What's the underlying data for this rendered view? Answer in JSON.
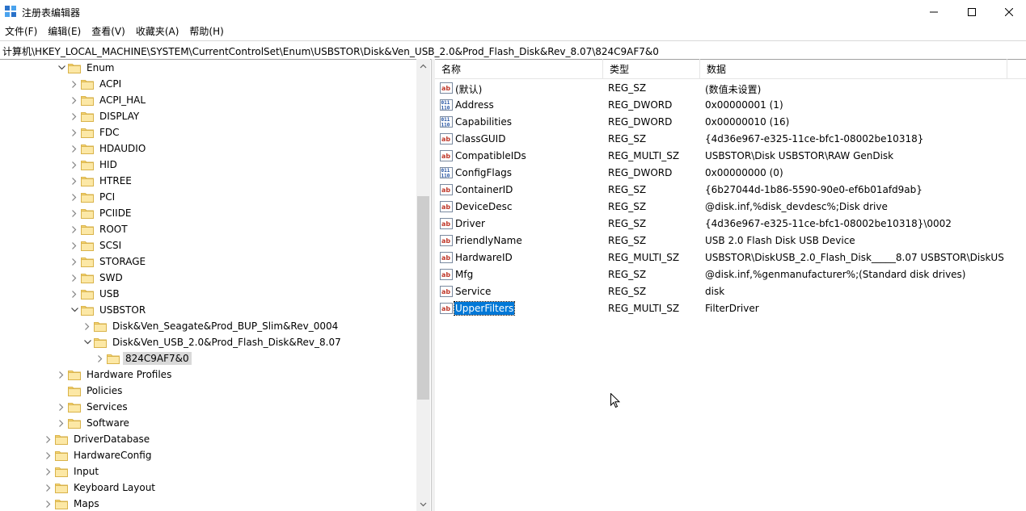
{
  "window": {
    "title": "注册表编辑器"
  },
  "menu": [
    "文件(F)",
    "编辑(E)",
    "查看(V)",
    "收藏夹(A)",
    "帮助(H)"
  ],
  "address": "计算机\\HKEY_LOCAL_MACHINE\\SYSTEM\\CurrentControlSet\\Enum\\USBSTOR\\Disk&Ven_USB_2.0&Prod_Flash_Disk&Rev_8.07\\824C9AF7&0",
  "tree": [
    {
      "label": "Enum",
      "expanded": true
    },
    {
      "label": "ACPI"
    },
    {
      "label": "ACPI_HAL"
    },
    {
      "label": "DISPLAY"
    },
    {
      "label": "FDC"
    },
    {
      "label": "HDAUDIO"
    },
    {
      "label": "HID"
    },
    {
      "label": "HTREE"
    },
    {
      "label": "PCI"
    },
    {
      "label": "PCIIDE"
    },
    {
      "label": "ROOT"
    },
    {
      "label": "SCSI"
    },
    {
      "label": "STORAGE"
    },
    {
      "label": "SWD"
    },
    {
      "label": "USB"
    },
    {
      "label": "USBSTOR",
      "expanded": true
    },
    {
      "label": "Disk&Ven_Seagate&Prod_BUP_Slim&Rev_0004"
    },
    {
      "label": "Disk&Ven_USB_2.0&Prod_Flash_Disk&Rev_8.07",
      "expanded": true
    },
    {
      "label": "824C9AF7&0",
      "selected": true
    },
    {
      "label": "Hardware Profiles"
    },
    {
      "label": "Policies"
    },
    {
      "label": "Services"
    },
    {
      "label": "Software"
    },
    {
      "label": "DriverDatabase"
    },
    {
      "label": "HardwareConfig"
    },
    {
      "label": "Input"
    },
    {
      "label": "Keyboard Layout"
    },
    {
      "label": "Maps"
    }
  ],
  "columns": {
    "name": "名称",
    "type": "类型",
    "data": "数据"
  },
  "values": [
    {
      "name": "(默认)",
      "type": "REG_SZ",
      "data": "(数值未设置)",
      "icon": "string-value-icon"
    },
    {
      "name": "Address",
      "type": "REG_DWORD",
      "data": "0x00000001 (1)",
      "icon": "binary-value-icon"
    },
    {
      "name": "Capabilities",
      "type": "REG_DWORD",
      "data": "0x00000010 (16)",
      "icon": "binary-value-icon"
    },
    {
      "name": "ClassGUID",
      "type": "REG_SZ",
      "data": "{4d36e967-e325-11ce-bfc1-08002be10318}",
      "icon": "string-value-icon"
    },
    {
      "name": "CompatibleIDs",
      "type": "REG_MULTI_SZ",
      "data": "USBSTOR\\Disk USBSTOR\\RAW GenDisk",
      "icon": "string-value-icon"
    },
    {
      "name": "ConfigFlags",
      "type": "REG_DWORD",
      "data": "0x00000000 (0)",
      "icon": "binary-value-icon"
    },
    {
      "name": "ContainerID",
      "type": "REG_SZ",
      "data": "{6b27044d-1b86-5590-90e0-ef6b01afd9ab}",
      "icon": "string-value-icon"
    },
    {
      "name": "DeviceDesc",
      "type": "REG_SZ",
      "data": "@disk.inf,%disk_devdesc%;Disk drive",
      "icon": "string-value-icon"
    },
    {
      "name": "Driver",
      "type": "REG_SZ",
      "data": "{4d36e967-e325-11ce-bfc1-08002be10318}\\0002",
      "icon": "string-value-icon"
    },
    {
      "name": "FriendlyName",
      "type": "REG_SZ",
      "data": "USB 2.0 Flash Disk USB Device",
      "icon": "string-value-icon"
    },
    {
      "name": "HardwareID",
      "type": "REG_MULTI_SZ",
      "data": "USBSTOR\\DiskUSB_2.0_Flash_Disk_____8.07 USBSTOR\\DiskUS...",
      "icon": "string-value-icon"
    },
    {
      "name": "Mfg",
      "type": "REG_SZ",
      "data": "@disk.inf,%genmanufacturer%;(Standard disk drives)",
      "icon": "string-value-icon"
    },
    {
      "name": "Service",
      "type": "REG_SZ",
      "data": "disk",
      "icon": "string-value-icon"
    },
    {
      "name": "UpperFilters",
      "type": "REG_MULTI_SZ",
      "data": "FilterDriver",
      "icon": "string-value-icon",
      "selected": true
    }
  ]
}
